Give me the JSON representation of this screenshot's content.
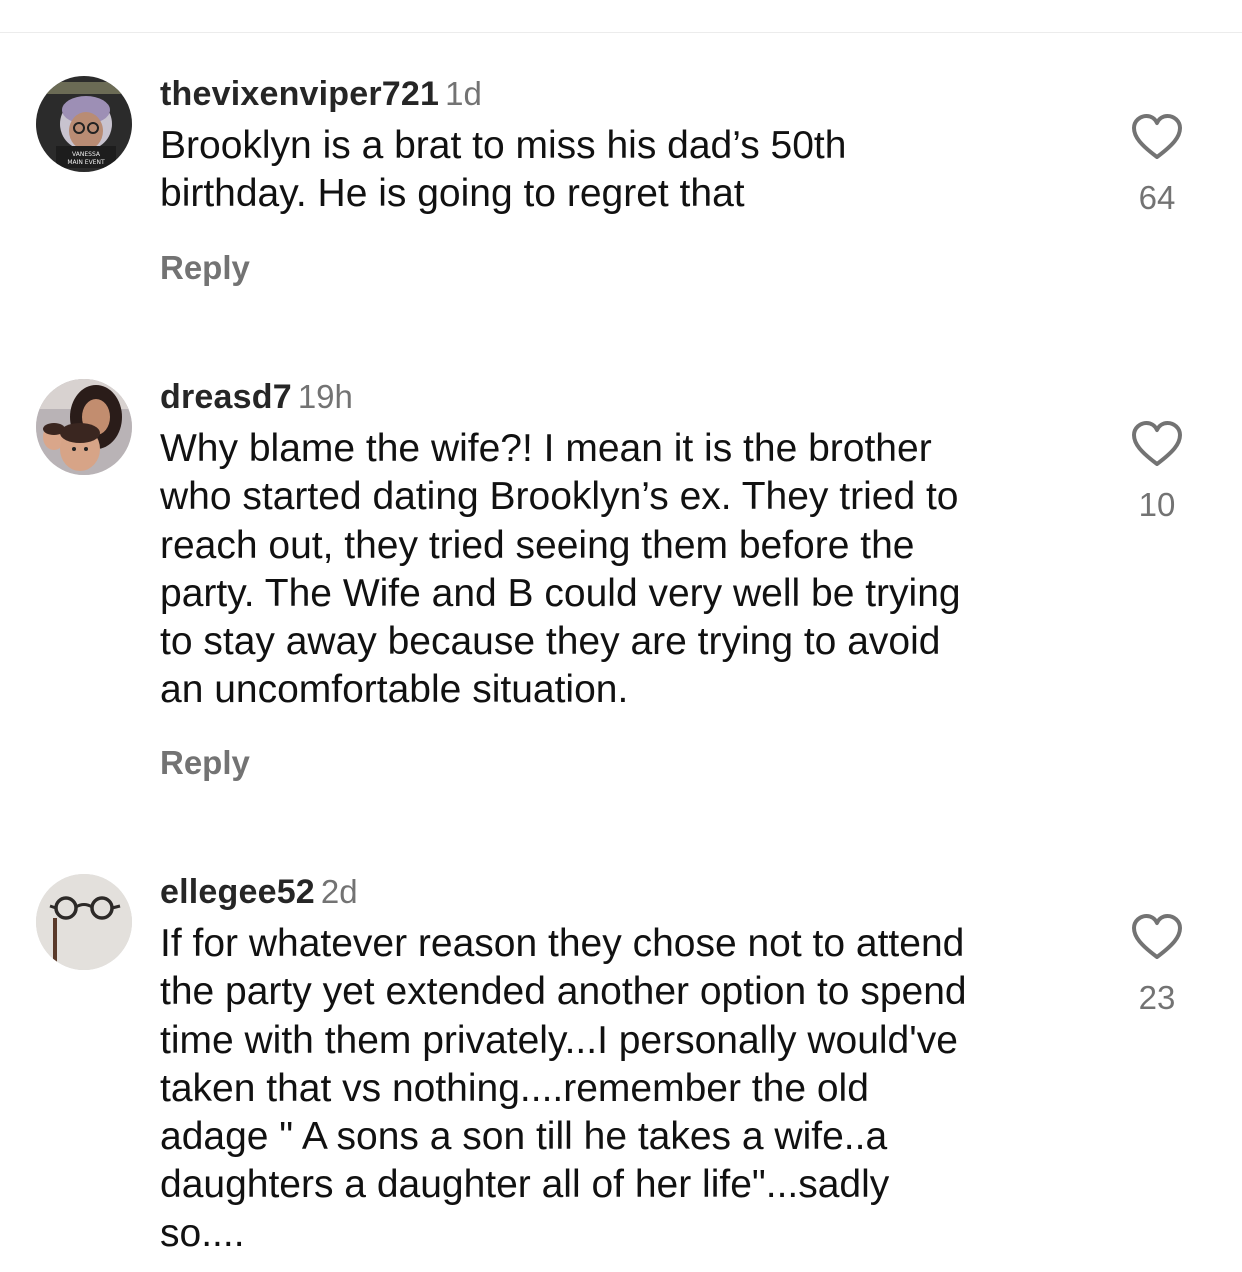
{
  "comments": [
    {
      "username": "thevixenviper721",
      "time": "1d",
      "text": "Brooklyn is a brat to miss his dad’s 50th\nbirthday. He is going to regret that",
      "reply_label": "Reply",
      "likes": "64",
      "avatar_text_top": "VANESSA",
      "avatar_text_bottom": "MAIN EVENT"
    },
    {
      "username": "dreasd7",
      "time": "19h",
      "text": "Why blame the wife?! I mean it is the brother\nwho started dating Brooklyn’s ex. They tried to\nreach out, they tried seeing them before the\nparty. The Wife and B could very well be  trying\nto stay away because they are trying to avoid\nan uncomfortable situation.",
      "reply_label": "Reply",
      "likes": "10"
    },
    {
      "username": "ellegee52",
      "time": "2d",
      "text": "If for whatever reason they chose not to attend\nthe party yet extended another option to spend\ntime with them privately...I personally would've\ntaken that vs nothing....remember the old\nadage \" A sons a son till he takes a wife..a\ndaughters a daughter all of her life\"...sadly\nso....",
      "likes": "23"
    }
  ],
  "colors": {
    "text": "#111111",
    "secondary": "#737373",
    "divider": "#ececec"
  },
  "icons": {
    "like": "heart-outline-icon"
  }
}
